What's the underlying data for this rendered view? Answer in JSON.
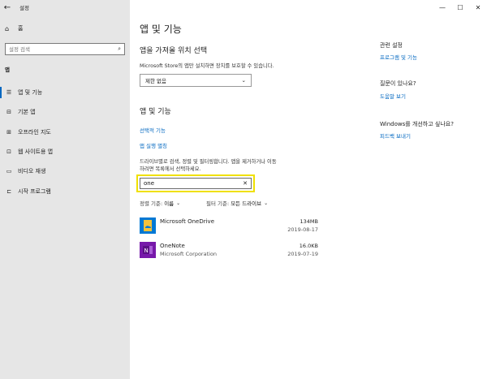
{
  "window": {
    "title": "설정",
    "controls": {
      "minimize": "—",
      "maximize": "☐",
      "close": "✕"
    }
  },
  "sidebar": {
    "home_label": "홈",
    "search_placeholder": "설정 검색",
    "section_label": "앱",
    "items": [
      {
        "label": "앱 및 기능",
        "icon": "list-icon",
        "glyph": "☰",
        "active": true
      },
      {
        "label": "기본 앱",
        "icon": "default-apps-icon",
        "glyph": "⊟",
        "active": false
      },
      {
        "label": "오프라인 지도",
        "icon": "map-icon",
        "glyph": "⊞",
        "active": false
      },
      {
        "label": "웹 사이트용 앱",
        "icon": "website-apps-icon",
        "glyph": "⊡",
        "active": false
      },
      {
        "label": "비디오 재생",
        "icon": "video-icon",
        "glyph": "▭",
        "active": false
      },
      {
        "label": "시작 프로그램",
        "icon": "startup-icon",
        "glyph": "⊏",
        "active": false
      }
    ]
  },
  "main": {
    "page_title": "앱 및 기능",
    "install_section": {
      "heading": "앱을 가져올 위치 선택",
      "description": "Microsoft Store의 앱만 설치하면 장치를 보호할 수 있습니다.",
      "dropdown_value": "제한 없음"
    },
    "apps_section": {
      "heading": "앱 및 기능",
      "optional_features_link": "선택적 기능",
      "app_aliases_link": "앱 실행 별칭",
      "description_line1": "드라이브별로 검색, 정렬 및 필터링합니다. 앱을 제거하거나 이동",
      "description_line2": "하려면 목록에서 선택하세요.",
      "search_value": "one",
      "sort_label": "정렬 기준:",
      "sort_value": "이름",
      "filter_label": "필터 기준:",
      "filter_value": "모든 드라이브",
      "apps": [
        {
          "name": "Microsoft OneDrive",
          "publisher": "",
          "size": "134MB",
          "date": "2019-08-17",
          "color": "#0078d4"
        },
        {
          "name": "OneNote",
          "publisher": "Microsoft Corporation",
          "size": "16.0KB",
          "date": "2019-07-19",
          "color": "#7719aa"
        }
      ]
    }
  },
  "right_panel": {
    "related_heading": "관련 설정",
    "programs_link": "프로그램 및 기능",
    "question_heading": "질문이 있나요?",
    "help_link": "도움말 보기",
    "improve_heading": "Windows를 개선하고 싶나요?",
    "feedback_link": "피드백 보내기"
  },
  "colors": {
    "accent": "#0067c0",
    "sidebar_bg": "#e6e6e6",
    "highlight_border": "#f0e000"
  }
}
